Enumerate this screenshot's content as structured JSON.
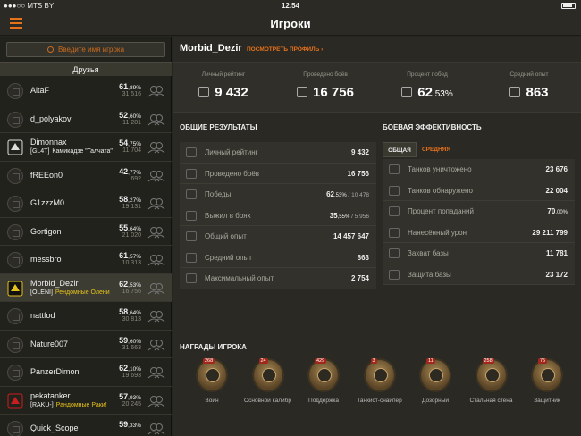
{
  "status": {
    "carrier": "●●●○○ MTS BY",
    "time": "12.54"
  },
  "topbar": {
    "title": "Игроки"
  },
  "sidebar": {
    "search_placeholder": "Введите имя игрока",
    "friends_header": "Друзья",
    "friends": [
      {
        "name": "AltaF",
        "pct": "61",
        "pct_dec": ",89%",
        "battles": "31 516",
        "clan": "",
        "clan_name": ""
      },
      {
        "name": "d_polyakov",
        "pct": "52",
        "pct_dec": ",60%",
        "battles": "11 281",
        "clan": "",
        "clan_name": ""
      },
      {
        "name": "Dimonnax",
        "pct": "54",
        "pct_dec": ",75%",
        "battles": "11 704",
        "clan": "[GL4T]",
        "clan_name": "Камикадзе \"Галчата\""
      },
      {
        "name": "fREEon0",
        "pct": "42",
        "pct_dec": ",77%",
        "battles": "692",
        "clan": "",
        "clan_name": ""
      },
      {
        "name": "G1zzzM0",
        "pct": "58",
        "pct_dec": ",27%",
        "battles": "19 131",
        "clan": "",
        "clan_name": ""
      },
      {
        "name": "Gortigon",
        "pct": "55",
        "pct_dec": ",64%",
        "battles": "21 020",
        "clan": "",
        "clan_name": ""
      },
      {
        "name": "messbro",
        "pct": "61",
        "pct_dec": ",57%",
        "battles": "10 313",
        "clan": "",
        "clan_name": ""
      },
      {
        "name": "Morbid_Dezir",
        "pct": "62",
        "pct_dec": ",53%",
        "battles": "16 756",
        "clan": "[OLENI]",
        "clan_name": "Рендомные Олени"
      },
      {
        "name": "nattfod",
        "pct": "58",
        "pct_dec": ",64%",
        "battles": "30 813",
        "clan": "",
        "clan_name": ""
      },
      {
        "name": "Nature007",
        "pct": "59",
        "pct_dec": ",60%",
        "battles": "31 663",
        "clan": "",
        "clan_name": ""
      },
      {
        "name": "PanzerDimon",
        "pct": "62",
        "pct_dec": ",10%",
        "battles": "19 693",
        "clan": "",
        "clan_name": ""
      },
      {
        "name": "pekatanker",
        "pct": "57",
        "pct_dec": ",93%",
        "battles": "20 245",
        "clan": "[RAKU-]",
        "clan_name": "Рандомные Раки!"
      },
      {
        "name": "Quick_Scope",
        "pct": "59",
        "pct_dec": ",33%",
        "battles": "",
        "clan": "",
        "clan_name": ""
      }
    ]
  },
  "profile": {
    "name": "Morbid_Dezir",
    "view_profile": "ПОСМОТРЕТЬ ПРОФИЛЬ  ›",
    "summary": [
      {
        "label": "Личный рейтинг",
        "value": "9 432",
        "small": "",
        "icon": "rating-icon"
      },
      {
        "label": "Проведено боёв",
        "value": "16 756",
        "small": "",
        "icon": "battles-icon"
      },
      {
        "label": "Процент побед",
        "value": "62",
        "small": ",53%",
        "icon": "victory-flag-icon"
      },
      {
        "label": "Средний опыт",
        "value": "863",
        "small": "",
        "icon": "avg-xp-icon"
      }
    ]
  },
  "overall": {
    "title": "ОБЩИЕ РЕЗУЛЬТАТЫ",
    "rows": [
      {
        "label": "Личный рейтинг",
        "value": "9 432",
        "small": "",
        "sub": ""
      },
      {
        "label": "Проведено боёв",
        "value": "16 756",
        "small": "",
        "sub": ""
      },
      {
        "label": "Победы",
        "value": "62",
        "small": ",53%",
        "sub": " / 10 478"
      },
      {
        "label": "Выжил в боях",
        "value": "35",
        "small": ",55%",
        "sub": " / 5 956"
      },
      {
        "label": "Общий опыт",
        "value": "14 457 647",
        "small": "",
        "sub": ""
      },
      {
        "label": "Средний опыт",
        "value": "863",
        "small": "",
        "sub": ""
      },
      {
        "label": "Максимальный опыт",
        "value": "2 754",
        "small": "",
        "sub": ""
      }
    ]
  },
  "combat": {
    "title": "БОЕВАЯ ЭФФЕКТИВНОСТЬ",
    "tabs": [
      "ОБЩАЯ",
      "СРЕДНЯЯ"
    ],
    "rows": [
      {
        "label": "Танков уничтожено",
        "value": "23 676",
        "small": ""
      },
      {
        "label": "Танков обнаружено",
        "value": "22 004",
        "small": ""
      },
      {
        "label": "Процент попаданий",
        "value": "70",
        "small": ",00%"
      },
      {
        "label": "Нанесённый урон",
        "value": "29 211 799",
        "small": ""
      },
      {
        "label": "Захват базы",
        "value": "11 781",
        "small": ""
      },
      {
        "label": "Защита базы",
        "value": "23 172",
        "small": ""
      }
    ]
  },
  "awards": {
    "title": "НАГРАДЫ ИГРОКА",
    "items": [
      {
        "label": "Воин",
        "count": "268"
      },
      {
        "label": "Основной калибр",
        "count": "24"
      },
      {
        "label": "Поддержка",
        "count": "429"
      },
      {
        "label": "Танкист-снайпер",
        "count": "3"
      },
      {
        "label": "Дозорный",
        "count": "11"
      },
      {
        "label": "Стальная стена",
        "count": "258"
      },
      {
        "label": "Защитник",
        "count": "75"
      }
    ]
  }
}
